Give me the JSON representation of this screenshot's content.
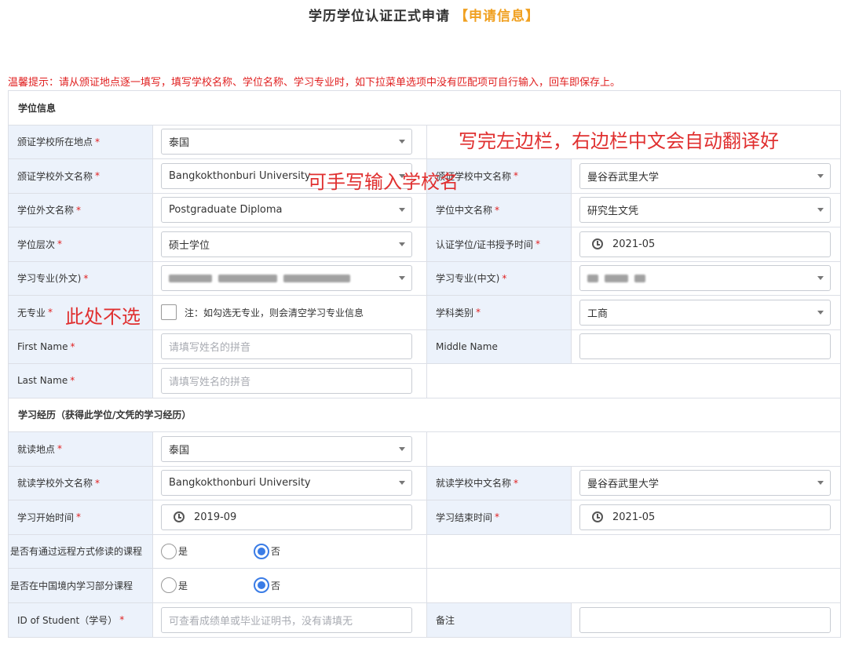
{
  "header": {
    "title": "学历学位认证正式申请",
    "subtitle": "【申请信息】"
  },
  "tip": "温馨提示：请从颁证地点逐一填写，填写学校名称、学位名称、学习专业时，如下拉菜单选项中没有匹配项可自行输入，回车即保存上。",
  "degree_section": {
    "title": "学位信息",
    "issuing_location": {
      "label": "颁证学校所在地点",
      "value": "泰国"
    },
    "school_foreign_name": {
      "label": "颁证学校外文名称",
      "value": "Bangkokthonburi University"
    },
    "school_chinese_name": {
      "label": "颁证学校中文名称",
      "value": "曼谷吞武里大学"
    },
    "degree_foreign_name": {
      "label": "学位外文名称",
      "value": "Postgraduate Diploma"
    },
    "degree_chinese_name": {
      "label": "学位中文名称",
      "value": "研究生文凭"
    },
    "degree_level": {
      "label": "学位层次",
      "value": "硕士学位"
    },
    "award_date": {
      "label": "认证学位/证书授予时间",
      "value": "2021-05"
    },
    "major_foreign": {
      "label": "学习专业(外文)"
    },
    "major_chinese": {
      "label": "学习专业(中文)"
    },
    "no_major": {
      "label": "无专业",
      "note": "注：如勾选无专业，则会清空学习专业信息"
    },
    "discipline": {
      "label": "学科类别",
      "value": "工商"
    },
    "first_name": {
      "label": "First Name",
      "placeholder": "请填写姓名的拼音"
    },
    "middle_name": {
      "label": "Middle Name"
    },
    "last_name": {
      "label": "Last Name",
      "placeholder": "请填写姓名的拼音"
    }
  },
  "study_section": {
    "title": "学习经历（获得此学位/文凭的学习经历）",
    "study_location": {
      "label": "就读地点",
      "value": "泰国"
    },
    "school_foreign_name": {
      "label": "就读学校外文名称",
      "value": "Bangkokthonburi University"
    },
    "school_chinese_name": {
      "label": "就读学校中文名称",
      "value": "曼谷吞武里大学"
    },
    "start_date": {
      "label": "学习开始时间",
      "value": "2019-09"
    },
    "end_date": {
      "label": "学习结束时间",
      "value": "2021-05"
    },
    "distance_learning": {
      "label": "是否有通过远程方式修读的课程",
      "yes": "是",
      "no": "否",
      "selected": "否"
    },
    "study_in_china": {
      "label": "是否在中国境内学习部分课程",
      "yes": "是",
      "no": "否",
      "selected": "否"
    },
    "student_id": {
      "label": "ID of Student（学号）",
      "placeholder": "可查看成绩单或毕业证明书，没有请填无"
    },
    "remarks": {
      "label": "备注"
    }
  },
  "annotations": {
    "right_column": "写完左边栏，右边栏中文会自动翻译好",
    "handwrite": "可手写输入学校名",
    "no_select": "此处不选"
  },
  "required_mark": "*",
  "colors": {
    "accent": "#f0a020",
    "required": "#e02020",
    "label_bg": "#ecf2fb",
    "radio": "#3a7ce6",
    "annotation": "#e03030"
  }
}
